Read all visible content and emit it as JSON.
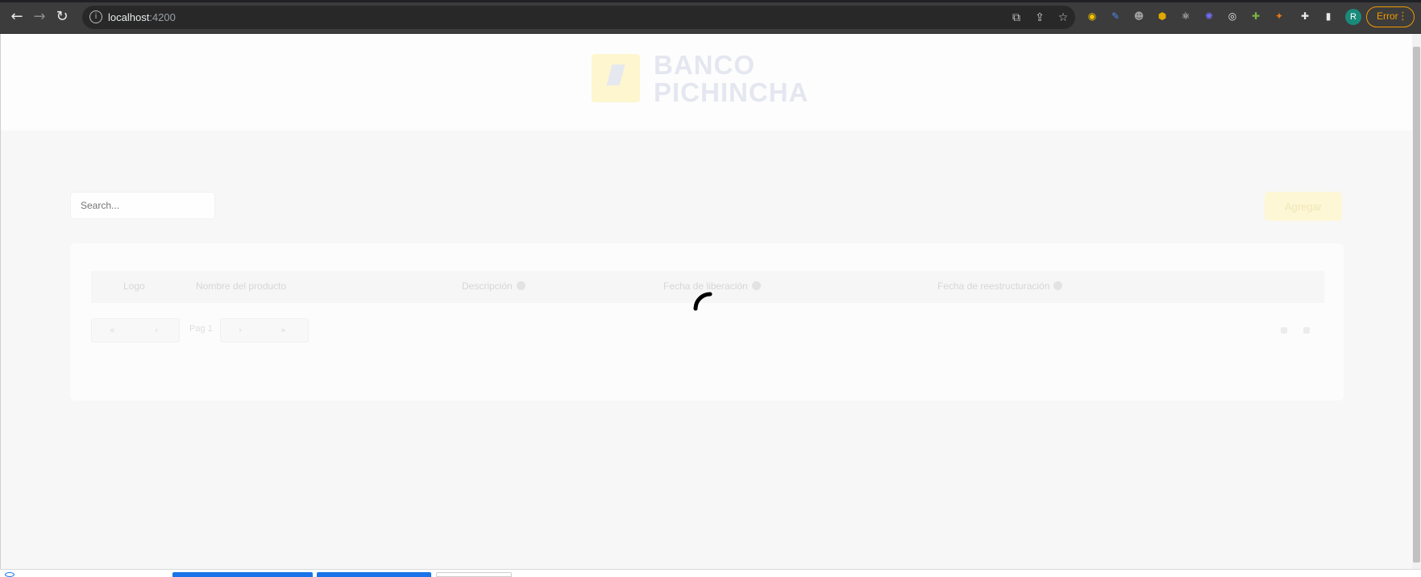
{
  "browser": {
    "url_host": "localhost",
    "url_port": ":4200",
    "profile_initial": "R",
    "error_label": "Error",
    "icons": {
      "back": "←",
      "forward": "→",
      "reload": "↻",
      "info": "i",
      "translate": "⧉",
      "share": "⇪",
      "star": "☆",
      "puzzle": "✚",
      "sidebar": "▮",
      "menu": "⋮"
    },
    "extensions": [
      {
        "name": "extension-1-icon",
        "glyph": "◉",
        "color": "#f2c300"
      },
      {
        "name": "extension-2-icon",
        "glyph": "✎",
        "color": "#4c8bf5"
      },
      {
        "name": "extension-3-icon",
        "glyph": "☻",
        "color": "#9e9e9e"
      },
      {
        "name": "extension-4-icon",
        "glyph": "⬢",
        "color": "#e0a800"
      },
      {
        "name": "react-devtools-icon",
        "glyph": "⚛",
        "color": "#e8eaed"
      },
      {
        "name": "extension-6-icon",
        "glyph": "✺",
        "color": "#6f6cf2"
      },
      {
        "name": "extension-7-icon",
        "glyph": "◎",
        "color": "#e8eaed"
      },
      {
        "name": "extension-8-icon",
        "glyph": "✚",
        "color": "#7cb342"
      },
      {
        "name": "metamask-icon",
        "glyph": "✦",
        "color": "#e2761b"
      }
    ]
  },
  "app": {
    "logo_line1": "BANCO",
    "logo_line2": "PICHINCHA",
    "search_placeholder": "Search...",
    "add_button_label": "Agregar",
    "table_headers": [
      "Logo",
      "Nombre del producto",
      "Descripción",
      "Fecha de liberación",
      "Fecha de reestructuración"
    ],
    "pager_first": "«",
    "pager_prev": "‹",
    "page_label": "Pag 1",
    "pager_next": "›",
    "pager_last": "»",
    "loading": true
  },
  "colors": {
    "brand_yellow": "#ffdd00",
    "brand_navy": "#0f265c",
    "spinner": "#000000"
  }
}
